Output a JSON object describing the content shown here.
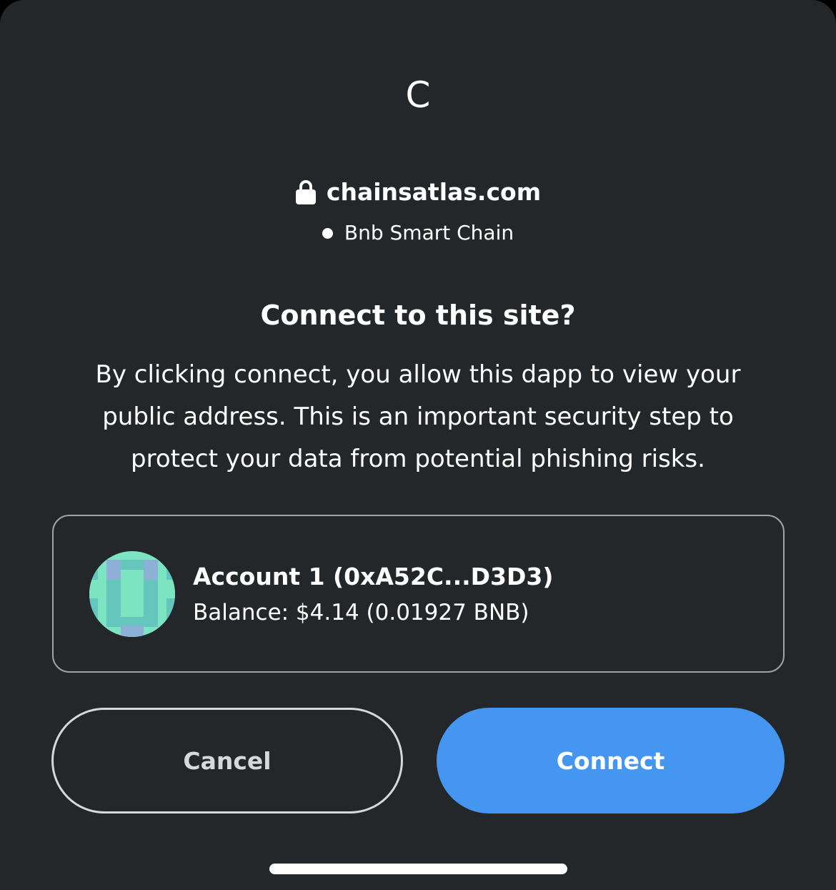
{
  "site": {
    "initial": "C",
    "origin": "chainsatlas.com",
    "network": "Bnb Smart Chain"
  },
  "prompt": {
    "title": "Connect to this site?",
    "description": "By clicking connect, you allow this dapp to view your public address. This is an important security step to protect your data from potential phishing risks."
  },
  "account": {
    "name": "Account 1 (0xA52C...D3D3)",
    "balance": "Balance: $4.14 (0.01927 BNB)",
    "avatar_icon": "jazzicon-avatar"
  },
  "actions": {
    "cancel_label": "Cancel",
    "connect_label": "Connect"
  },
  "colors": {
    "background": "#24272a",
    "primary": "#4596f0",
    "card_border": "#9fa3a7"
  }
}
